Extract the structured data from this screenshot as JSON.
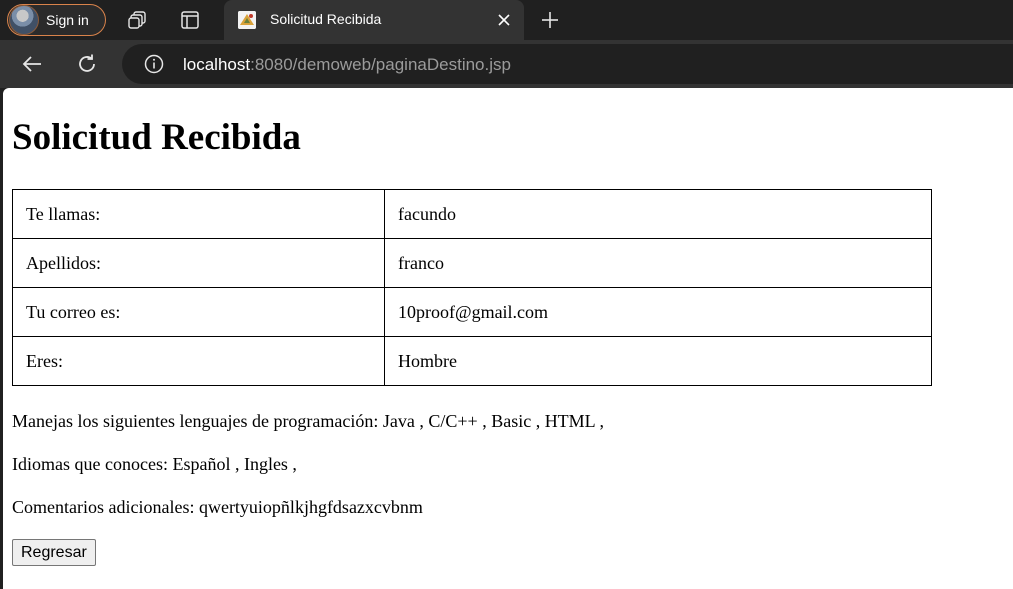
{
  "browser": {
    "signin_label": "Sign in",
    "tab_title": "Solicitud Recibida",
    "url_host": "localhost",
    "url_rest": ":8080/demoweb/paginaDestino.jsp"
  },
  "page": {
    "heading": "Solicitud Recibida",
    "rows": [
      {
        "label": "Te llamas:",
        "value": "facundo"
      },
      {
        "label": "Apellidos:",
        "value": "franco"
      },
      {
        "label": "Tu correo es:",
        "value": "10proof@gmail.com"
      },
      {
        "label": "Eres:",
        "value": "Hombre"
      }
    ],
    "languages_text": "Manejas los siguientes lenguajes de programación: Java , C/C++ , Basic , HTML ,",
    "idiomas_text": "Idiomas que conoces: Español , Ingles ,",
    "comments_text": "Comentarios adicionales: qwertyuiopñlkjhgfdsazxcvbnm",
    "back_button": "Regresar"
  }
}
